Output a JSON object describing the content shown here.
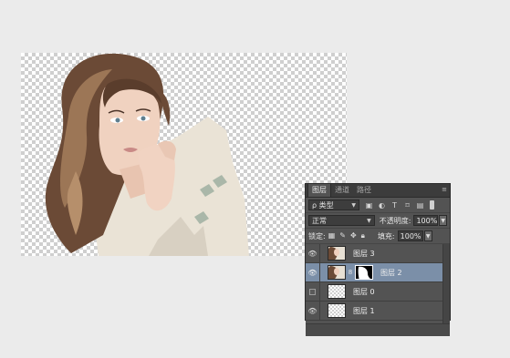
{
  "document": {
    "description_icon": "portrait-cutout"
  },
  "layers_panel": {
    "tabs": [
      {
        "label": "图层",
        "active": true
      },
      {
        "label": "通道",
        "active": false
      },
      {
        "label": "路径",
        "active": false
      }
    ],
    "filter": {
      "kind_label": "ρ 类型",
      "icons": [
        "image-filter-icon",
        "adjustment-filter-icon",
        "type-filter-icon",
        "shape-filter-icon",
        "smart-object-filter-icon"
      ]
    },
    "blend_mode": "正常",
    "opacity_label": "不透明度:",
    "opacity_value": "100%",
    "lock_label": "锁定:",
    "fill_label": "填充:",
    "fill_value": "100%",
    "layers": [
      {
        "name": "图层 3",
        "visible": true,
        "selected": false,
        "thumb": "photo",
        "mask": false
      },
      {
        "name": "图层 2",
        "visible": true,
        "selected": true,
        "thumb": "photo",
        "mask": true
      },
      {
        "name": "图层 0",
        "visible": false,
        "selected": false,
        "thumb": "checker",
        "mask": false
      },
      {
        "name": "图层 1",
        "visible": true,
        "selected": false,
        "thumb": "checker",
        "mask": false
      }
    ]
  },
  "colors": {
    "panel_bg": "#535353",
    "selected_row": "#7b8fa8"
  }
}
